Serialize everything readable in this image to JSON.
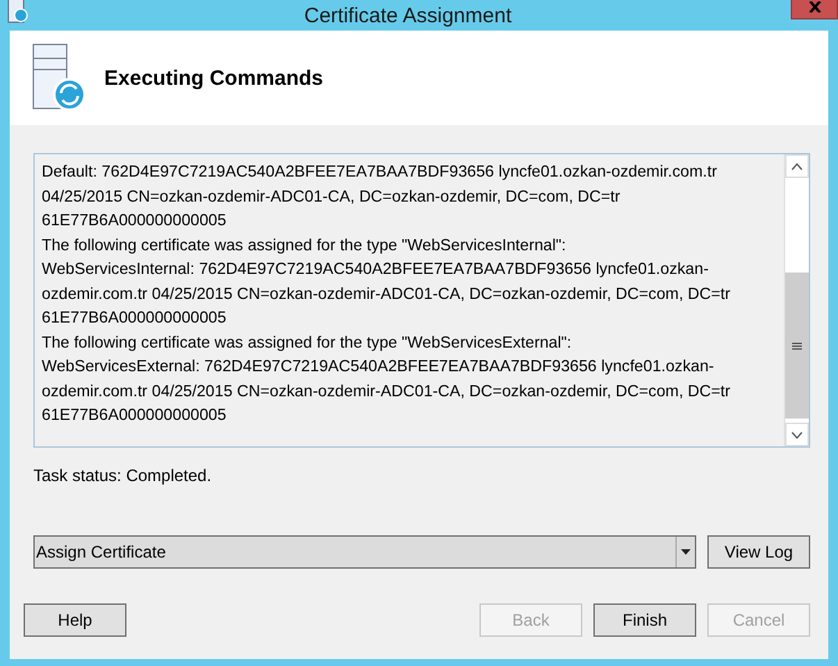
{
  "window": {
    "title": "Certificate Assignment"
  },
  "header": {
    "title": "Executing Commands"
  },
  "log": {
    "lines": [
      "Default: 762D4E97C7219AC540A2BFEE7EA7BAA7BDF93656 lyncfe01.ozkan-ozdemir.com.tr",
      "04/25/2015 CN=ozkan-ozdemir-ADC01-CA, DC=ozkan-ozdemir, DC=com, DC=tr",
      "61E77B6A000000000005",
      "The following certificate was assigned for the type \"WebServicesInternal\":",
      "WebServicesInternal: 762D4E97C7219AC540A2BFEE7EA7BAA7BDF93656 lyncfe01.ozkan-",
      "ozdemir.com.tr 04/25/2015 CN=ozkan-ozdemir-ADC01-CA, DC=ozkan-ozdemir, DC=com, DC=tr",
      "61E77B6A000000000005",
      "The following certificate was assigned for the type \"WebServicesExternal\":",
      "WebServicesExternal: 762D4E97C7219AC540A2BFEE7EA7BAA7BDF93656 lyncfe01.ozkan-",
      "ozdemir.com.tr 04/25/2015 CN=ozkan-ozdemir-ADC01-CA, DC=ozkan-ozdemir, DC=com, DC=tr",
      "61E77B6A000000000005"
    ]
  },
  "task_status": "Task status: Completed.",
  "action": {
    "value": "Assign Certificate"
  },
  "view_log_button": {
    "label": "View Log",
    "disabled": false
  },
  "buttons": [
    {
      "label": "Help",
      "disabled": false
    },
    {
      "label": "Back",
      "disabled": true
    },
    {
      "label": "Finish",
      "disabled": false
    },
    {
      "label": "Cancel",
      "disabled": true
    }
  ]
}
